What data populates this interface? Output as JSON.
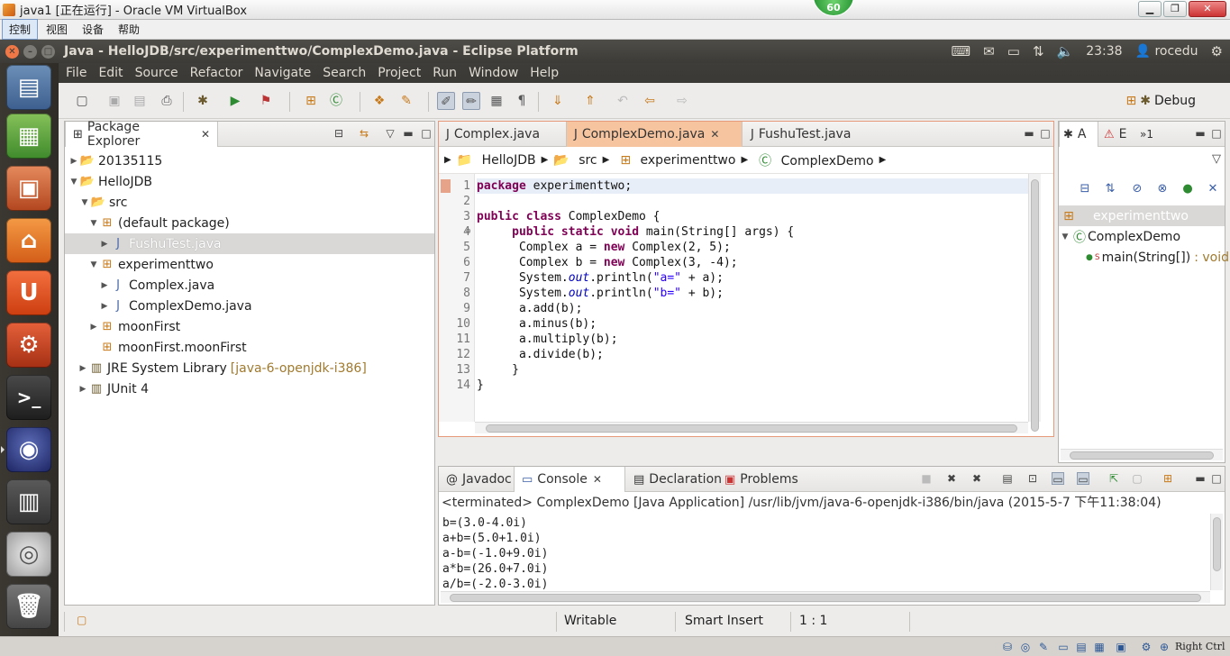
{
  "vbox": {
    "title": "java1 [正在运行] - Oracle VM VirtualBox",
    "badge": "60",
    "menu": [
      "控制",
      "视图",
      "设备",
      "帮助"
    ],
    "host_key": "Right Ctrl"
  },
  "panel": {
    "window_title": "Java - HelloJDB/src/experimenttwo/ComplexDemo.java - Eclipse Platform",
    "clock": "23:38",
    "user": "rocedu"
  },
  "menubar": [
    "File",
    "Edit",
    "Source",
    "Refactor",
    "Navigate",
    "Search",
    "Project",
    "Run",
    "Window",
    "Help"
  ],
  "perspective": {
    "label": "Debug"
  },
  "package_explorer": {
    "title": "Package Explorer",
    "items": [
      {
        "label": "20135115",
        "icon": "project-icon",
        "twist": "▶"
      },
      {
        "label": "HelloJDB",
        "icon": "project-icon",
        "twist": "▼"
      },
      {
        "label": "src",
        "icon": "source-folder-icon",
        "twist": "▼"
      },
      {
        "label": "(default package)",
        "icon": "package-icon",
        "twist": "▼"
      },
      {
        "label": "FushuTest.java",
        "icon": "java-file-icon",
        "twist": "▶"
      },
      {
        "label": "experimenttwo",
        "icon": "package-icon",
        "twist": "▼"
      },
      {
        "label": "Complex.java",
        "icon": "java-file-icon",
        "twist": "▶"
      },
      {
        "label": "ComplexDemo.java",
        "icon": "java-file-icon",
        "twist": "▶"
      },
      {
        "label": "moonFirst",
        "icon": "package-icon",
        "twist": "▶"
      },
      {
        "label": "moonFirst.moonFirst",
        "icon": "package-icon",
        "twist": ""
      },
      {
        "label": "JRE System Library",
        "icon": "library-icon",
        "twist": "▶",
        "decor": "[java-6-openjdk-i386]"
      },
      {
        "label": "JUnit 4",
        "icon": "library-icon",
        "twist": "▶"
      }
    ]
  },
  "editor": {
    "tabs": [
      "Complex.java",
      "ComplexDemo.java",
      "FushuTest.java"
    ],
    "breadcrumb": [
      "HelloJDB",
      "src",
      "experimenttwo",
      "ComplexDemo"
    ],
    "line_numbers": [
      "1",
      "2",
      "3",
      "4",
      "5",
      "6",
      "7",
      "8",
      "9",
      "10",
      "11",
      "12",
      "13",
      "14"
    ]
  },
  "outline": {
    "tabs": [
      "A",
      "E",
      "»1"
    ],
    "items": [
      "experimenttwo",
      "ComplexDemo",
      "main(String[])",
      ": void"
    ],
    "static_marker": "S"
  },
  "console": {
    "tabs": [
      "Javadoc",
      "Console",
      "Declaration",
      "Problems"
    ],
    "info": "<terminated> ComplexDemo [Java Application] /usr/lib/jvm/java-6-openjdk-i386/bin/java (2015-5-7 下午11:38:04)",
    "lines": [
      "b=(3.0-4.0i)",
      "a+b=(5.0+1.0i)",
      "a-b=(-1.0+9.0i)",
      "a*b=(26.0+7.0i)",
      "a/b=(-2.0-3.0i)"
    ]
  },
  "statusbar": {
    "writable": "Writable",
    "insert_mode": "Smart Insert",
    "position": "1 : 1"
  },
  "colors": {
    "accent_tab": "#f6c59f",
    "keyword": "#7f0055",
    "string": "#2a00ff",
    "panel": "#3c3b37"
  }
}
